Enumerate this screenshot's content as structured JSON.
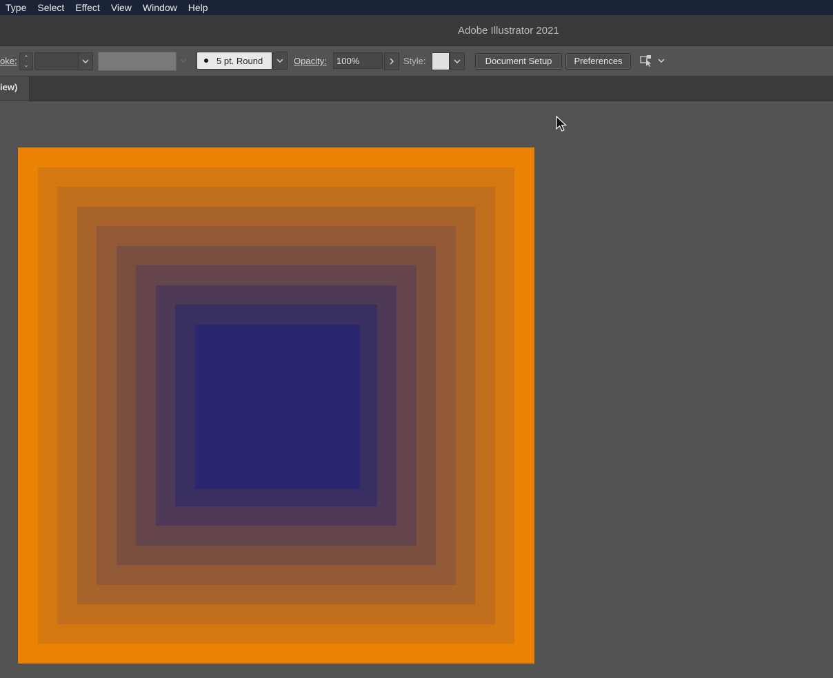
{
  "menubar": {
    "items": [
      "Type",
      "Select",
      "Effect",
      "View",
      "Window",
      "Help"
    ]
  },
  "window": {
    "title": "Adobe Illustrator 2021"
  },
  "control_bar": {
    "stroke_label": "oke:",
    "stroke_weight_value": "",
    "brush_label": "5 pt. Round",
    "opacity_label": "Opacity:",
    "opacity_value": "100%",
    "style_label": "Style:",
    "document_setup_label": "Document Setup",
    "preferences_label": "Preferences",
    "arrange_icon": "arrange-documents-icon"
  },
  "document_tab": {
    "label": "iew)"
  },
  "artwork": {
    "squares": [
      {
        "color": "#ec8204"
      },
      {
        "color": "#d5780f"
      },
      {
        "color": "#c06e1c"
      },
      {
        "color": "#a8632a"
      },
      {
        "color": "#915935"
      },
      {
        "color": "#7a4f3f"
      },
      {
        "color": "#64454b"
      },
      {
        "color": "#4e3a56"
      },
      {
        "color": "#3a2f61"
      },
      {
        "color": "#2a266f"
      }
    ]
  },
  "colors": {
    "menubar_bg": "#1b2436",
    "workspace_bg": "#535353"
  }
}
